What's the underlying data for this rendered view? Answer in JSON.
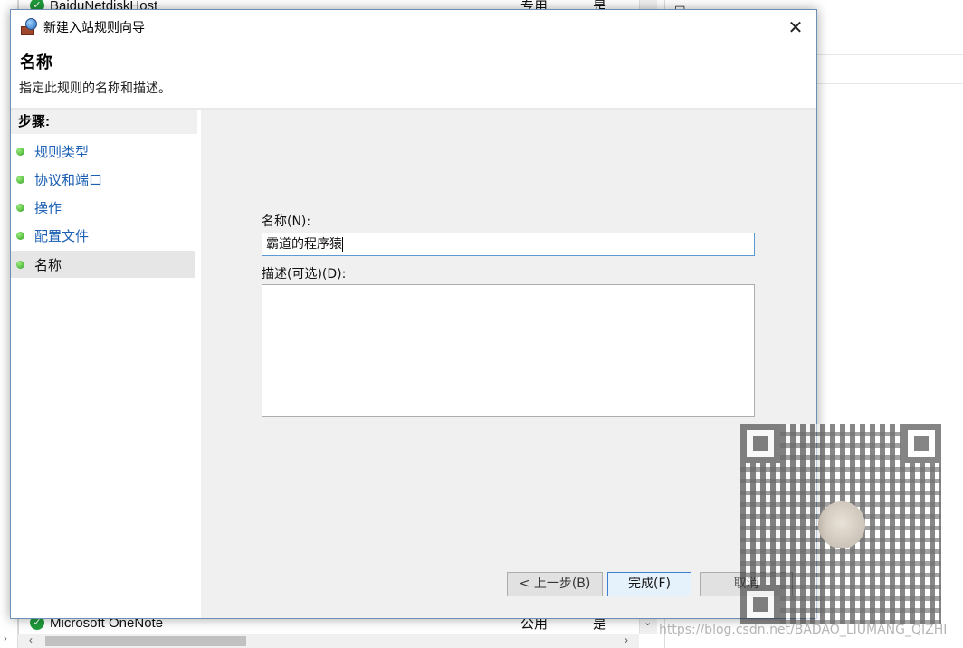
{
  "background_window": {
    "rows": [
      {
        "name": "BaiduNetdiskHost",
        "profile": "专用",
        "enabled": "是"
      },
      {
        "name": "Microsoft OneNote",
        "profile": "公用",
        "enabled": "是"
      }
    ],
    "actions_fragment": "☐ ⋯⋯"
  },
  "dialog": {
    "title": "新建入站规则向导",
    "close_symbol": "✕",
    "heading": "名称",
    "description": "指定此规则的名称和描述。",
    "steps_title": "步骤:",
    "steps": [
      {
        "label": "规则类型",
        "current": false
      },
      {
        "label": "协议和端口",
        "current": false
      },
      {
        "label": "操作",
        "current": false
      },
      {
        "label": "配置文件",
        "current": false
      },
      {
        "label": "名称",
        "current": true
      }
    ],
    "name_label": "名称(N):",
    "name_value": "霸道的程序猿",
    "desc_label": "描述(可选)(D):",
    "desc_value": "",
    "buttons": {
      "back": "< 上一步(B)",
      "finish": "完成(F)",
      "cancel": "取消"
    }
  },
  "watermark": "https://blog.csdn.net/BADAO_LIUMANG_QIZHI",
  "colors": {
    "link": "#1a5fb4",
    "step_dot": "#2e9d20",
    "input_focus_border": "#5c9ad6",
    "content_bg": "#f0f0f0"
  }
}
